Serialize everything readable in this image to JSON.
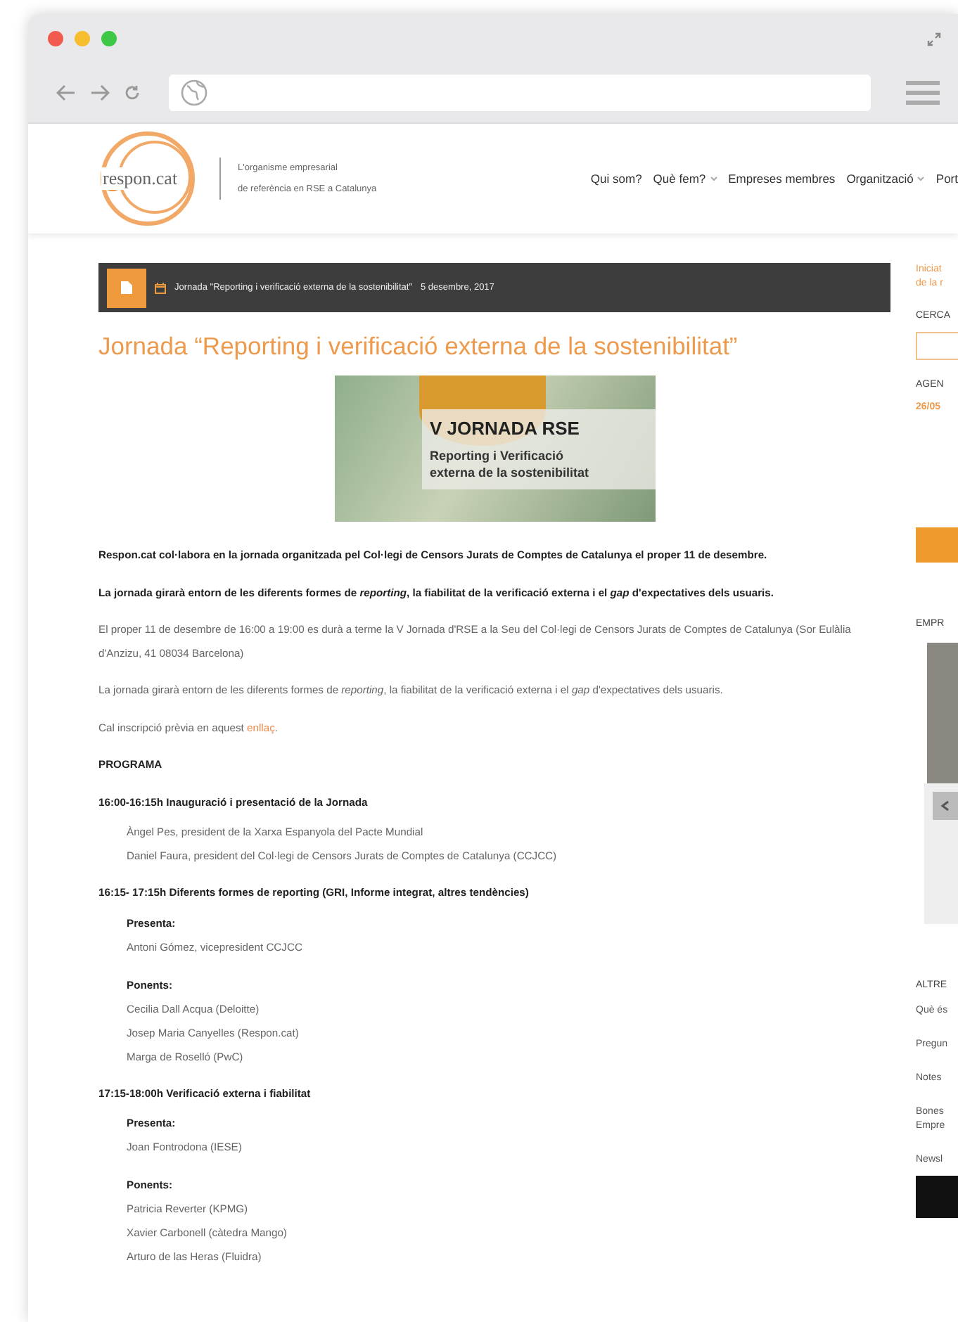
{
  "header": {
    "logo": "respon.cat",
    "tagline": [
      "L'organisme empresarial",
      "de referència en RSE a Catalunya"
    ],
    "nav": [
      {
        "label": "Qui som?",
        "dropdown": false
      },
      {
        "label": "Què fem?",
        "dropdown": true
      },
      {
        "label": "Empreses membres",
        "dropdown": false
      },
      {
        "label": "Organització",
        "dropdown": true
      },
      {
        "label": "Port",
        "dropdown": false
      }
    ]
  },
  "breadcrumb": {
    "text": "Jornada \"Reporting i verificació externa de la sostenibilitat\"",
    "date": "5 desembre, 2017"
  },
  "article": {
    "title": "Jornada “Reporting i verificació externa de la sostenibilitat”",
    "banner": {
      "heading": "V JORNADA RSE",
      "subtitle": [
        "Reporting i Verificació",
        "externa de la sostenibilitat"
      ]
    },
    "paragraphs": [
      {
        "kind": "bold",
        "text": "Respon.cat col·labora en la jornada organitzada pel Col·legi de Censors Jurats de Comptes de Catalunya el proper 11 de desembre."
      },
      {
        "kind": "bold",
        "text": "La jornada girarà entorn de les diferents formes de *reporting*, la fiabilitat de la verificació externa i el *gap* d'expectatives dels usuaris."
      },
      {
        "kind": "plain",
        "text": "El proper 11 de desembre de 16:00 a 19:00 es durà a terme la V Jornada d'RSE a la Seu del Col·legi de Censors Jurats de Comptes de Catalunya (Sor Eulàlia d'Anzizu, 41 08034 Barcelona)"
      },
      {
        "kind": "plain",
        "text": "La jornada girarà entorn de les diferents formes de *reporting*, la fiabilitat de la verificació externa i el *gap* d'expectatives dels usuaris."
      },
      {
        "kind": "link",
        "text": "Cal inscripció prèvia en aquest ",
        "link": "enllaç",
        "after": "."
      },
      {
        "kind": "heading",
        "text": "PROGRAMA"
      }
    ],
    "program": [
      {
        "heading": "16:00-16:15h Inauguració i presentació de la Jornada",
        "groups": [
          {
            "lines": [
              "Àngel Pes, president de la Xarxa Espanyola del Pacte Mundial",
              "Daniel Faura, president del Col·legi de Censors Jurats de Comptes de Catalunya (CCJCC)"
            ]
          }
        ]
      },
      {
        "heading": "16:15- 17:15h  Diferents formes de reporting (GRI, Informe integrat, altres tendències)",
        "groups": [
          {
            "label": "Presenta:",
            "lines": [
              "Antoni Gómez, vicepresident CCJCC"
            ]
          },
          {
            "label": "Ponents:",
            "lines": [
              "Cecilia Dall Acqua (Deloitte)",
              "Josep Maria Canyelles (Respon.cat)",
              "Marga de Roselló (PwC)"
            ]
          }
        ]
      },
      {
        "heading": "17:15-18:00h  Verificació externa i fiabilitat",
        "groups": [
          {
            "label": "Presenta:",
            "lines": [
              "Joan Fontrodona (IESE)"
            ]
          },
          {
            "label": "Ponents:",
            "lines": [
              "Patricia Reverter (KPMG)",
              "Xavier Carbonell (càtedra Mango)",
              "Arturo de las Heras (Fluidra)"
            ]
          }
        ]
      }
    ]
  },
  "sidebar": {
    "intro": [
      "Iniciat",
      "de la r"
    ],
    "search_heading": "CERCA",
    "agenda_heading": "AGEN",
    "agenda_date": "26/05",
    "members_heading": "EMPR",
    "others_heading": "ALTRE",
    "links": [
      {
        "lines": [
          "Què és"
        ]
      },
      {
        "lines": [
          "Pregun"
        ]
      },
      {
        "lines": [
          "Notes"
        ]
      },
      {
        "lines": [
          "Bones",
          "Empre"
        ]
      },
      {
        "lines": [
          "Newsl"
        ]
      }
    ]
  }
}
